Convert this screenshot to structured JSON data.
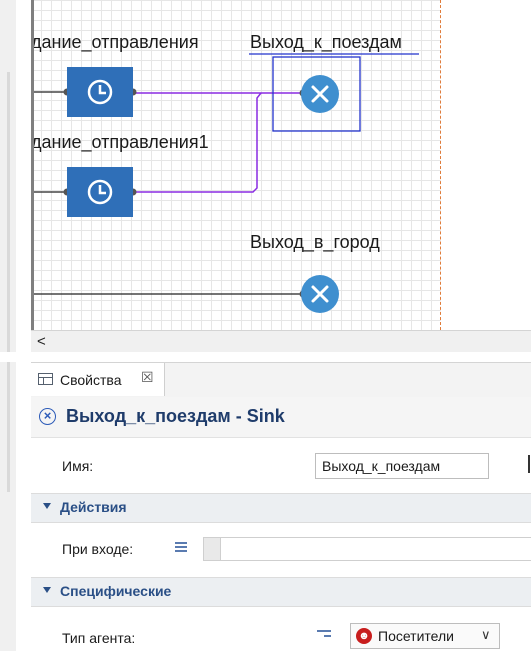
{
  "canvas": {
    "labels": {
      "departure_schedule": "дание_отправления",
      "exit_to_trains": "Выход_к_поездам",
      "departure_schedule_1": "дание_отправления1",
      "exit_to_city": "Выход_в_город"
    },
    "colors": {
      "block_blue": "#2f6fb8",
      "sink_blue": "#3f8fcf",
      "connector_purple": "#8a2be2",
      "selection_blue": "#2233cc",
      "boundary_orange": "#e07b39"
    },
    "icons": [
      "clock-icon",
      "sink-x-icon"
    ]
  },
  "scrollbar": {
    "left_arrow": "<"
  },
  "properties_tab": {
    "label": "Свойства",
    "close": "☒"
  },
  "properties": {
    "title": "Выход_к_поездам - Sink",
    "name_label": "Имя:",
    "name_value": "Выход_к_поездам",
    "sections": {
      "actions": "Действия",
      "specific": "Специфические"
    },
    "on_enter_label": "При входе:",
    "agent_type_label": "Тип агента:",
    "agent_type_value": "Посетители",
    "agent_caret": "∨"
  }
}
